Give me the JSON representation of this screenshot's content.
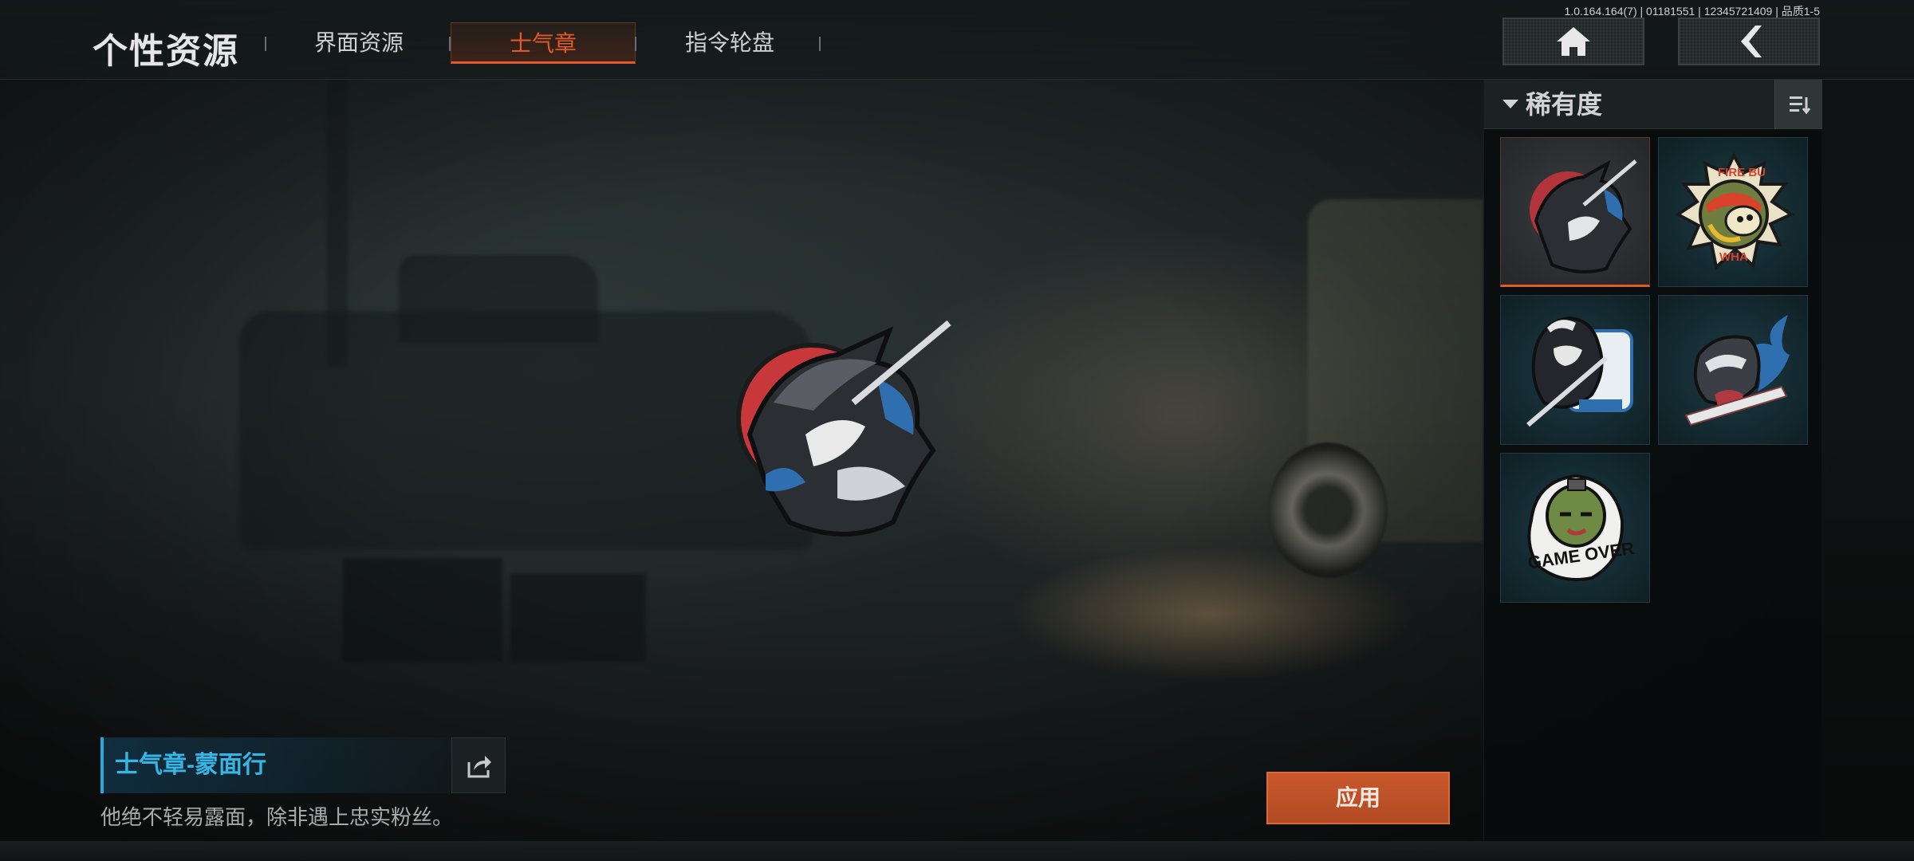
{
  "header": {
    "title": "个性资源",
    "version": "1.0.164.164(7) | 01181551 | 12345721409 | 品质1-5",
    "tabs": [
      {
        "label": "界面资源",
        "active": false
      },
      {
        "label": "士气章",
        "active": true
      },
      {
        "label": "指令轮盘",
        "active": false
      }
    ],
    "buttons": {
      "home_icon": "home-icon",
      "back_icon": "chevron-left-icon"
    }
  },
  "detail": {
    "name": "士气章-蒙面行",
    "description": "他绝不轻易露面，除非遇上忠实粉丝。",
    "apply_label": "应用"
  },
  "sidebar": {
    "filter_label": "稀有度",
    "items": [
      {
        "icon": "masked-ronin-emblem",
        "selected": true
      },
      {
        "icon": "fire-bunny-emblem",
        "selected": false
      },
      {
        "icon": "hooded-swordsman-emblem",
        "selected": false
      },
      {
        "icon": "blue-flame-warrior-emblem",
        "selected": false
      },
      {
        "icon": "game-over-grenade-emblem",
        "selected": false
      }
    ],
    "item_labels": [
      "FIRE BU",
      "WHA",
      "GAME OVER"
    ]
  },
  "colors": {
    "accent": "#e05a2b",
    "info_blue": "#35b6e6",
    "apply_button": "#c8582c",
    "panel_bg": "#0b0f10"
  }
}
